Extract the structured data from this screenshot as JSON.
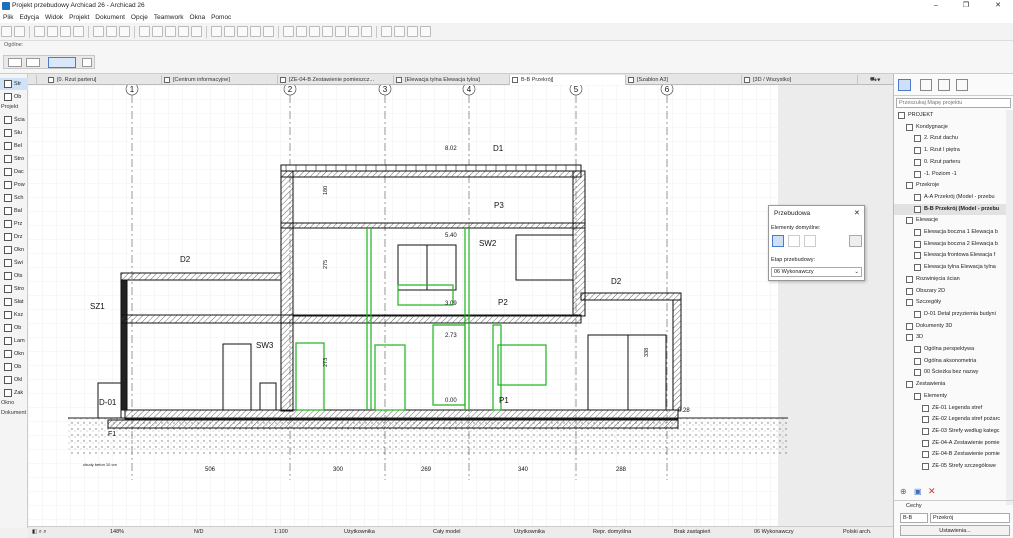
{
  "window": {
    "title": "Projekt przebudowy Archicad 26 - Archicad 26"
  },
  "menu": [
    "Plik",
    "Edycja",
    "Widok",
    "Projekt",
    "Dokument",
    "Opcje",
    "Teamwork",
    "Okna",
    "Pomoc"
  ],
  "infobox": {
    "label": "Ogólne:"
  },
  "tabs": [
    "[0. Rzut parteru]",
    "[Centrum informacyjne]",
    "[ZE-04-B Zestawienie pomieszcz...",
    "[Elewacja tylna Elewacja tylna]",
    "B-B Przekrój]",
    "[Szablon A3]",
    "[3D / Wszystko]"
  ],
  "toolbox": {
    "items_top": [
      "Str",
      "Ob"
    ],
    "section_projekt": "Projekt",
    "items_projekt": [
      "Ścia",
      "Słu",
      "Bel",
      "Stro",
      "Dac",
      "Pow",
      "Sch",
      "Bal",
      "Prz",
      "Drz",
      "Okn",
      "Świ",
      "Ots",
      "Stro",
      "Słat",
      "Ksz",
      "Ob",
      "Lam",
      "Okn",
      "Ob",
      "Okl",
      "Zak"
    ],
    "section_okno": "Okno",
    "section_dokument": "Dokument"
  },
  "drawing": {
    "gridlines": [
      "1",
      "2",
      "3",
      "4",
      "5",
      "6"
    ],
    "dims": [
      "506",
      "300",
      "269",
      "340",
      "288"
    ],
    "levels": [
      "8.02",
      "5.40",
      "3.09",
      "2.73",
      "0.00",
      "-0.28"
    ],
    "labels": {
      "D1": "D1",
      "D2a": "D2",
      "D2b": "D2",
      "P3": "P3",
      "SW2": "SW2",
      "P2": "P2",
      "SZ1": "SZ1",
      "SW3": "SW3",
      "P1": "P1",
      "D01": "D-01",
      "F1": "F1"
    },
    "small_dims": [
      "180",
      "275",
      "273",
      "338"
    ],
    "note": "chudy beton 10 cm"
  },
  "renovation": {
    "title": "Przebudowa",
    "defaults_label": "Elementy domyślne:",
    "phase_label": "Etap przebudowy:",
    "phase_value": "06 Wykonawczy"
  },
  "navigator": {
    "search_placeholder": "Przeszukaj Mapę projektu",
    "items": [
      {
        "label": "PROJEKT",
        "indent": 0
      },
      {
        "label": "Kondygnacje",
        "indent": 1
      },
      {
        "label": "2. Rzut dachu",
        "indent": 2
      },
      {
        "label": "1. Rzut I piętra",
        "indent": 2
      },
      {
        "label": "0. Rzut parteru",
        "indent": 2
      },
      {
        "label": "-1. Poziom -1",
        "indent": 2
      },
      {
        "label": "Przekroje",
        "indent": 1
      },
      {
        "label": "A-A Przekrój (Model - przebu",
        "indent": 2
      },
      {
        "label": "B-B Przekrój (Model - przebu",
        "indent": 2,
        "selected": true
      },
      {
        "label": "Elewacje",
        "indent": 1
      },
      {
        "label": "Elewacja boczna 1 Elewacja b",
        "indent": 2
      },
      {
        "label": "Elewacja boczna 2 Elewacja b",
        "indent": 2
      },
      {
        "label": "Elewacja frontowa Elewacja f",
        "indent": 2
      },
      {
        "label": "Elewacja tylna Elewacja tylna",
        "indent": 2
      },
      {
        "label": "Rozwinięcia ścian",
        "indent": 1
      },
      {
        "label": "Obszary 2D",
        "indent": 1
      },
      {
        "label": "Szczegóły",
        "indent": 1
      },
      {
        "label": "D-01 Detal przyziemia budyni",
        "indent": 2
      },
      {
        "label": "Dokumenty 3D",
        "indent": 1
      },
      {
        "label": "3D",
        "indent": 1
      },
      {
        "label": "Ogólna perspektywa",
        "indent": 2
      },
      {
        "label": "Ogólna aksonometria",
        "indent": 2
      },
      {
        "label": "00 Ścieżka bez nazwy",
        "indent": 2
      },
      {
        "label": "Zestawienia",
        "indent": 1
      },
      {
        "label": "Elementy",
        "indent": 2
      },
      {
        "label": "ZE-01 Legenda stref",
        "indent": 3
      },
      {
        "label": "ZE-02 Legenda stref pożarc",
        "indent": 3
      },
      {
        "label": "ZE-03 Strefy według kategc",
        "indent": 3
      },
      {
        "label": "ZE-04-A Zestawienie pomie",
        "indent": 3
      },
      {
        "label": "ZE-04-B Zestawienie pomie",
        "indent": 3
      },
      {
        "label": "ZE-05 Strefy szczegółowe",
        "indent": 3
      }
    ],
    "props_label": "Cechy",
    "props_id": "B-B",
    "props_name": "Przekrój",
    "settings_button": "Ustawienia..."
  },
  "status": {
    "zoom": "148%",
    "nd": "N/D",
    "scale": "1:100",
    "user1": "Użytkownika",
    "model": "Cały model",
    "user2": "Użytkownika",
    "repr": "Repr. domyślna",
    "replace": "Brak zastąpień",
    "phase": "06 Wykonawczy",
    "lang": "Polski arch."
  }
}
